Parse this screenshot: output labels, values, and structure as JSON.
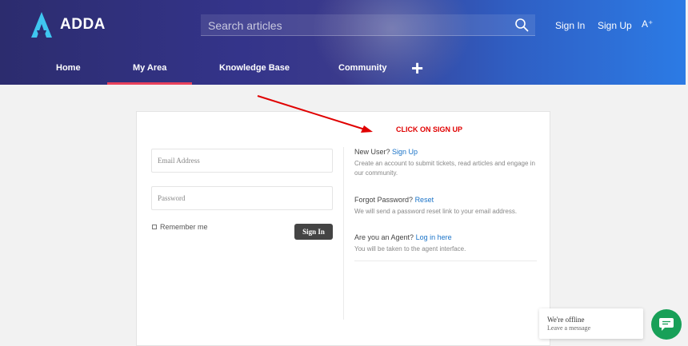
{
  "header": {
    "logo_text": "ADDA",
    "search_placeholder": "Search articles",
    "sign_in": "Sign In",
    "sign_up": "Sign Up",
    "font_toggle": "A⁺"
  },
  "nav": {
    "home": "Home",
    "my_area": "My Area",
    "knowledge_base": "Knowledge Base",
    "community": "Community",
    "add": "+"
  },
  "login": {
    "email_placeholder": "Email Address",
    "password_placeholder": "Password",
    "remember_me": "Remember me",
    "sign_in_button": "Sign In"
  },
  "info": {
    "new_user_prefix": "New User?",
    "new_user_link": "Sign Up",
    "new_user_desc": "Create an account to submit tickets, read articles and engage in our community.",
    "forgot_prefix": "Forgot Password?",
    "forgot_link": "Reset",
    "forgot_desc": "We will send a password reset link to your email address.",
    "agent_prefix": "Are you an Agent?",
    "agent_link": "Log in here",
    "agent_desc": "You will be taken to the agent interface."
  },
  "annotation": {
    "text": "CLICK ON SIGN UP",
    "color": "#e00000"
  },
  "chat": {
    "status": "We're offline",
    "sub": "Leave a message"
  },
  "colors": {
    "accent": "#e8415c",
    "link": "#1a73c8",
    "chat": "#18a058"
  }
}
